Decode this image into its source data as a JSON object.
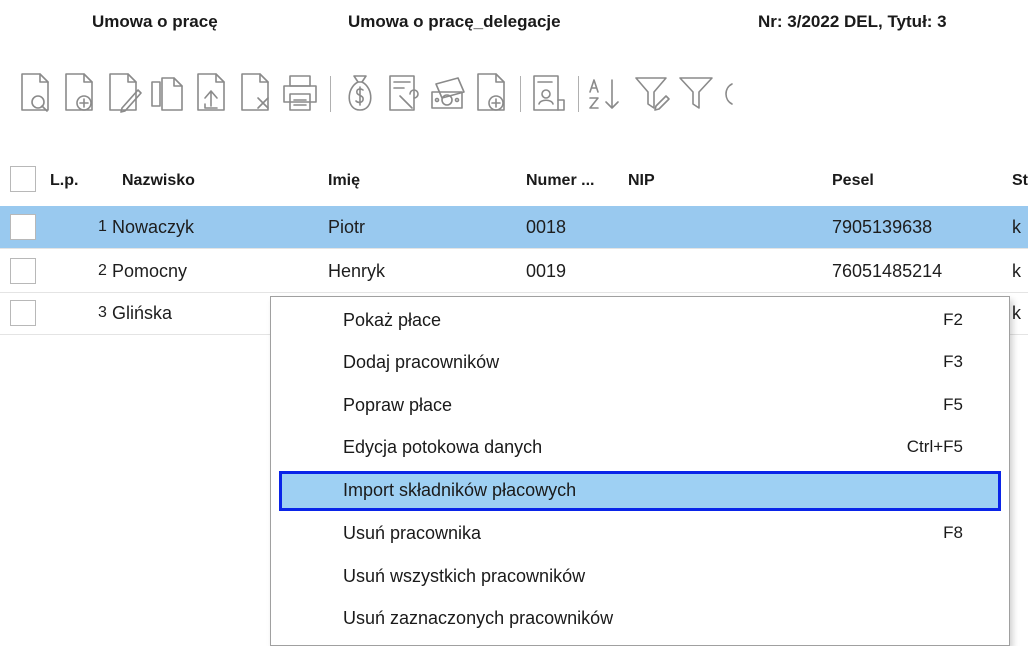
{
  "header": {
    "contract_type": "Umowa o pracę",
    "payroll_name": "Umowa o pracę_delegacje",
    "doc_number": "Nr: 3/2022 DEL, Tytuł: 3"
  },
  "toolbar": {
    "icons": [
      "preview-doc-icon",
      "add-doc-icon",
      "edit-doc-icon",
      "copy-doc-icon",
      "export-doc-icon",
      "delete-doc-icon",
      "print-icon",
      "money-bag-icon",
      "list-wrench-icon",
      "cash-icon",
      "add-doc-icon",
      "contract-icon",
      "sort-az-icon",
      "filter-edit-icon",
      "filter-icon"
    ]
  },
  "table": {
    "columns": [
      "L.p.",
      "Nazwisko",
      "Imię",
      "Numer ...",
      "NIP",
      "Pesel",
      "St"
    ],
    "rows": [
      {
        "lp": "1",
        "nazwisko": "Nowaczyk",
        "imie": "Piotr",
        "numer": "0018",
        "nip": "",
        "pesel": "7905139638",
        "st": "k"
      },
      {
        "lp": "2",
        "nazwisko": "Pomocny",
        "imie": "Henryk",
        "numer": "0019",
        "nip": "",
        "pesel": "76051485214",
        "st": "k"
      },
      {
        "lp": "3",
        "nazwisko": "Glińska",
        "imie": "",
        "numer": "",
        "nip": "",
        "pesel": "",
        "st": "k"
      }
    ],
    "selected_row": 1
  },
  "context_menu": {
    "items": [
      {
        "label": "Pokaż płace",
        "shortcut": "F2"
      },
      {
        "label": "Dodaj pracowników",
        "shortcut": "F3"
      },
      {
        "label": "Popraw płace",
        "shortcut": "F5"
      },
      {
        "label": "Edycja potokowa danych",
        "shortcut": "Ctrl+F5"
      },
      {
        "label": "Import składników płacowych",
        "shortcut": ""
      },
      {
        "label": "Usuń pracownika",
        "shortcut": "F8"
      },
      {
        "label": "Usuń wszystkich pracowników",
        "shortcut": ""
      },
      {
        "label": "Usuń zaznaczonych pracowników",
        "shortcut": ""
      }
    ],
    "highlighted_index": 4
  },
  "colors": {
    "selected_row": "#99c9ef",
    "menu_highlight": "#9ed0f3",
    "menu_highlight_border": "#0a24e8"
  }
}
